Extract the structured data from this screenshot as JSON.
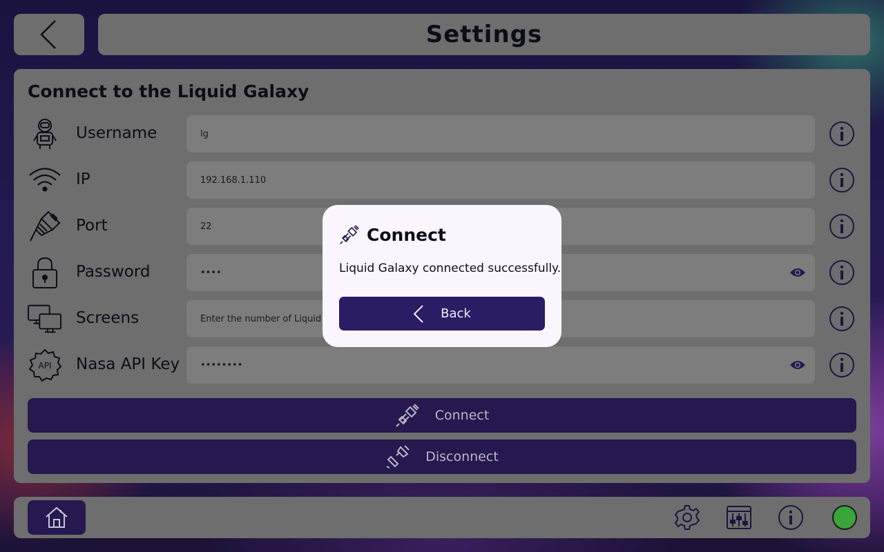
{
  "header": {
    "title": "Settings"
  },
  "section": {
    "title": "Connect to the Liquid Galaxy"
  },
  "fields": [
    {
      "label": "Username",
      "value": "lg",
      "placeholder": "",
      "icon": "astronaut-icon"
    },
    {
      "label": "IP",
      "value": "192.168.1.110",
      "placeholder": "",
      "icon": "wifi-icon"
    },
    {
      "label": "Port",
      "value": "22",
      "placeholder": "",
      "icon": "ethernet-plug-icon"
    },
    {
      "label": "Password",
      "value": "••••",
      "placeholder": "",
      "icon": "lock-icon"
    },
    {
      "label": "Screens",
      "value": "",
      "placeholder": "Enter the number of Liquid G",
      "icon": "monitors-icon"
    },
    {
      "label": "Nasa API Key",
      "value": "••••••••",
      "placeholder": "",
      "icon": "api-gear-icon"
    }
  ],
  "actions": {
    "connect_label": "Connect",
    "disconnect_label": "Disconnect"
  },
  "dialog": {
    "title": "Connect",
    "message": "Liquid Galaxy connected successfully.",
    "back_label": "Back"
  },
  "status": {
    "connected": true,
    "color": "#3aa33a"
  }
}
